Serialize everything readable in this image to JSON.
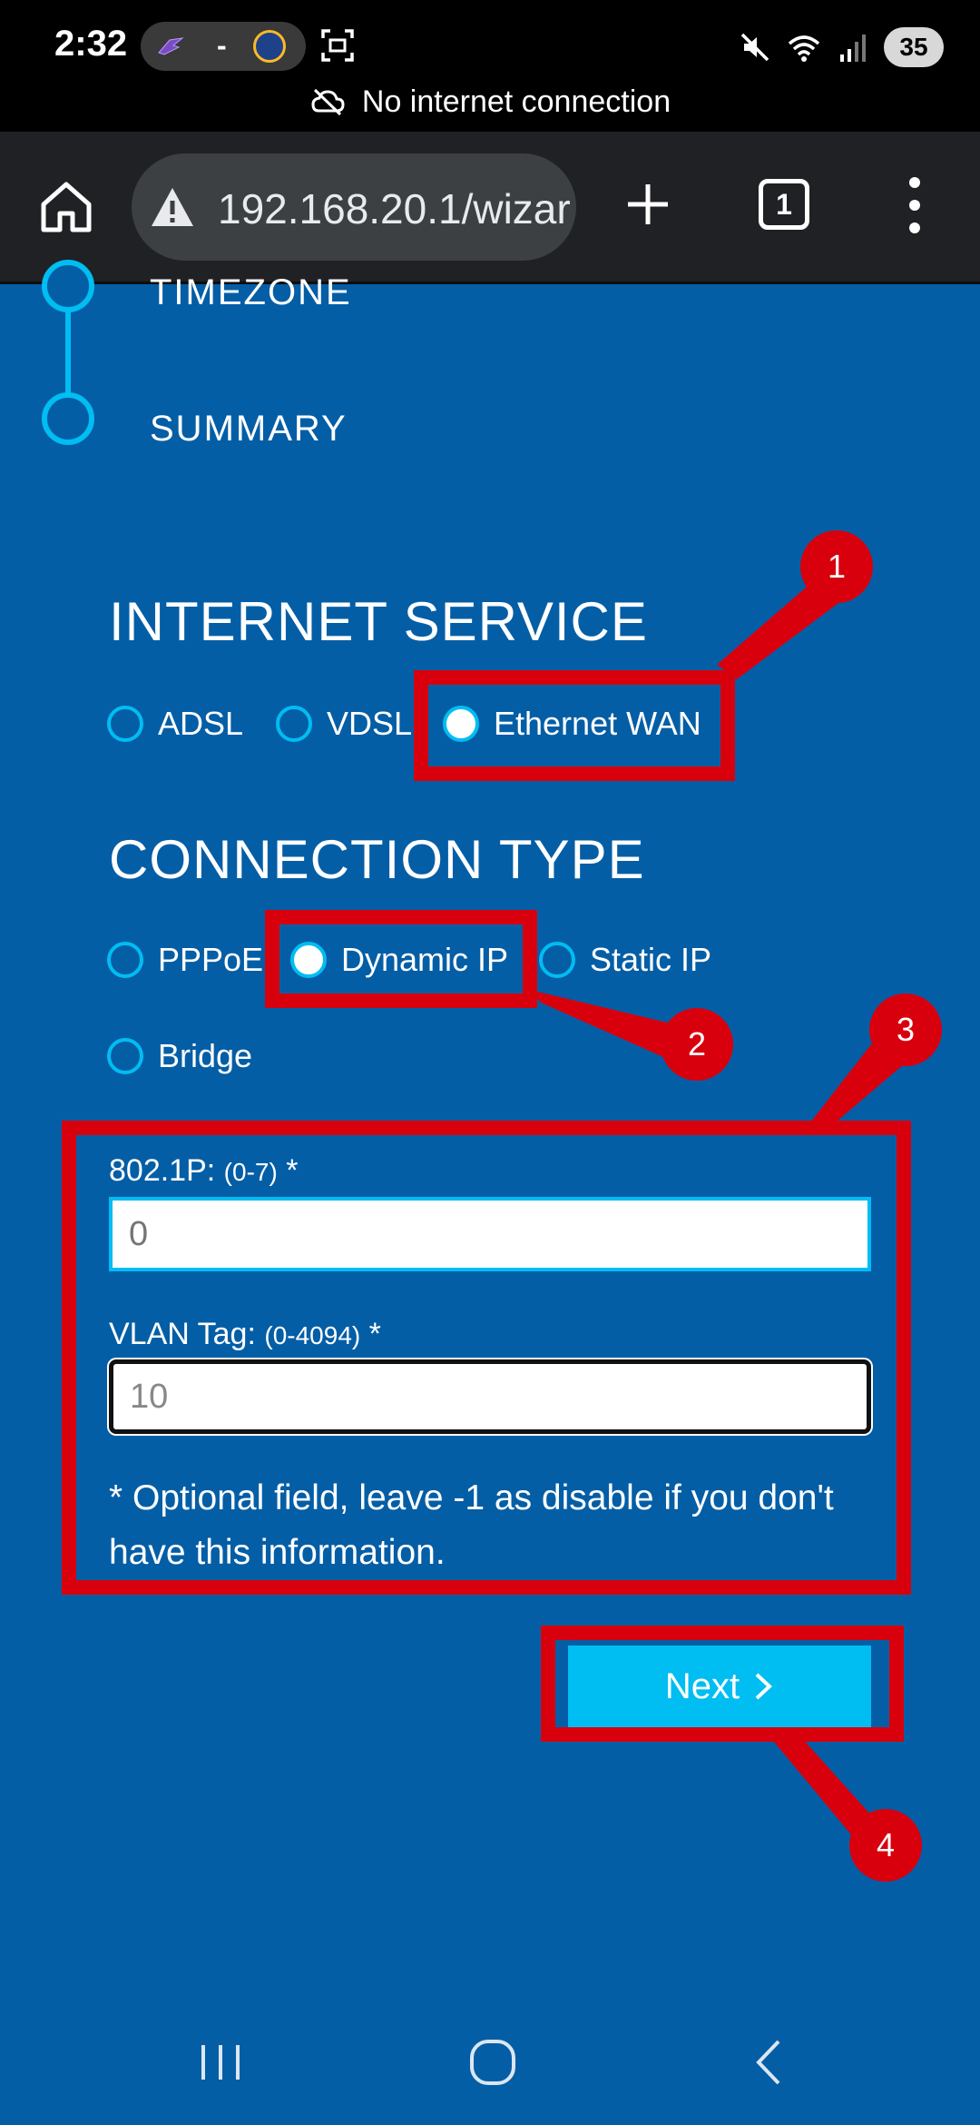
{
  "status_bar": {
    "time": "2:32",
    "separator": "-",
    "battery": "35",
    "notice": "No internet connection"
  },
  "browser": {
    "url": "192.168.20.1/wizar",
    "tab_count": "1"
  },
  "steps": [
    {
      "label": "TIMEZONE"
    },
    {
      "label": "SUMMARY"
    }
  ],
  "internet_service": {
    "title": "INTERNET SERVICE",
    "options": [
      {
        "label": "ADSL",
        "selected": false
      },
      {
        "label": "VDSL",
        "selected": false
      },
      {
        "label": "Ethernet WAN",
        "selected": true
      }
    ]
  },
  "connection_type": {
    "title": "CONNECTION TYPE",
    "options": [
      {
        "label": "PPPoE",
        "selected": false
      },
      {
        "label": "Dynamic IP",
        "selected": true
      },
      {
        "label": "Static IP",
        "selected": false
      },
      {
        "label": "Bridge",
        "selected": false
      }
    ]
  },
  "fields": {
    "priority_label": "802.1P:",
    "priority_range": "(0-7)",
    "priority_required": "*",
    "priority_placeholder": "0",
    "vlan_label": "VLAN Tag:",
    "vlan_range": "(0-4094)",
    "vlan_required": "*",
    "vlan_value": "10"
  },
  "note": "* Optional field, leave -1 as disable if you don't have this information.",
  "next_button": {
    "label": "Next"
  },
  "annotations": [
    "1",
    "2",
    "3",
    "4"
  ],
  "colors": {
    "background": "#045ea6",
    "accent": "#00bdf2",
    "annotation": "#d9000d"
  }
}
